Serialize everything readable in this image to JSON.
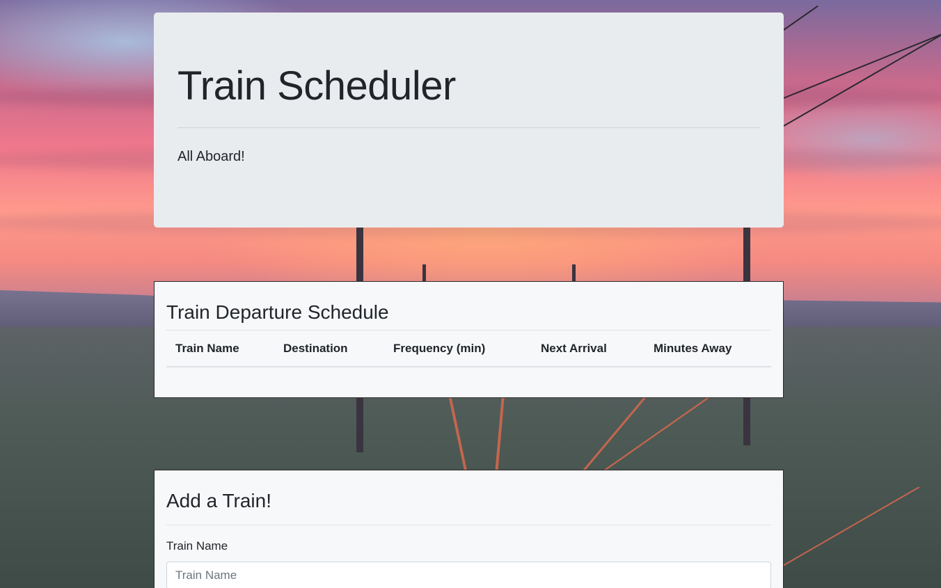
{
  "jumbotron": {
    "title": "Train Scheduler",
    "lead": "All Aboard!"
  },
  "schedule": {
    "title": "Train Departure Schedule",
    "columns": [
      "Train Name",
      "Destination",
      "Frequency (min)",
      "Next Arrival",
      "Minutes Away"
    ],
    "rows": []
  },
  "add_train": {
    "title": "Add a Train!",
    "train_name_label": "Train Name",
    "train_name_placeholder": "Train Name",
    "train_name_value": ""
  }
}
